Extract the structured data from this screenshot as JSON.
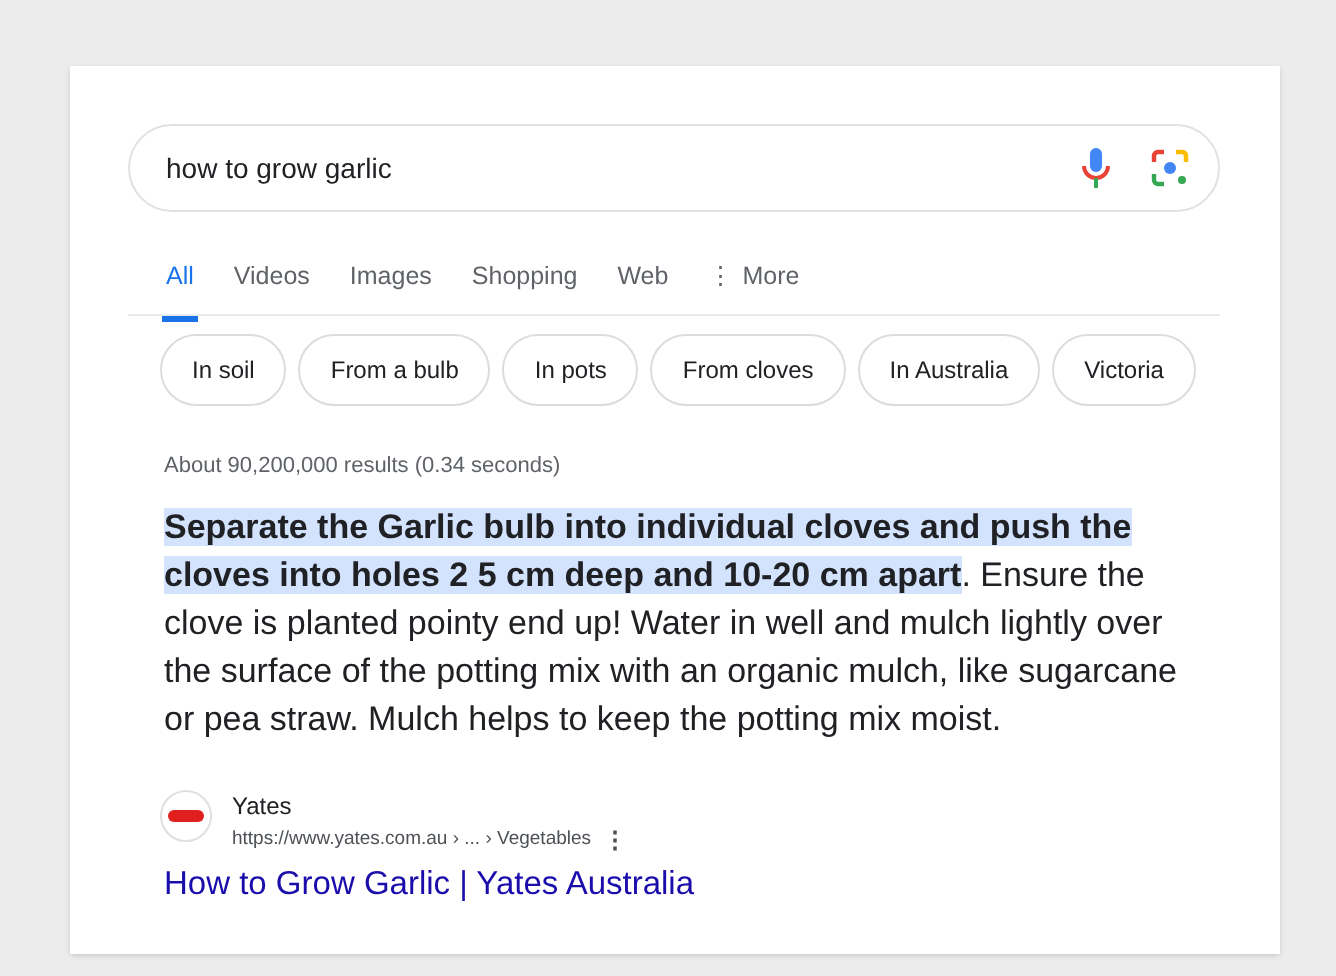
{
  "search": {
    "value": "how to grow garlic"
  },
  "tabs": [
    {
      "label": "All",
      "selected": true
    },
    {
      "label": "Videos",
      "selected": false
    },
    {
      "label": "Images",
      "selected": false
    },
    {
      "label": "Shopping",
      "selected": false
    },
    {
      "label": "Web",
      "selected": false
    },
    {
      "label": "More",
      "selected": false
    }
  ],
  "more_icon": "⋮",
  "chips": [
    "In soil",
    "From a bulb",
    "In pots",
    "From cloves",
    "In Australia",
    "Victoria"
  ],
  "result_stats": "About 90,200,000 results (0.34 seconds)",
  "snippet": "**Separate the Garlic bulb into individual cloves and push the cloves into holes 2 5 cm deep and 10-20 cm apart**. Ensure the clove is planted pointy end up! Water in well and mulch lightly over the surface of the potting mix with an organic mulch, like sugarcane or pea straw. Mulch helps to keep the potting mix moist.",
  "source": {
    "site": "Yates",
    "url": "https://www.yates.com.au › ... › Vegetables",
    "menu_icon": "⋮",
    "title": "How to Grow Garlic | Yates Australia"
  }
}
